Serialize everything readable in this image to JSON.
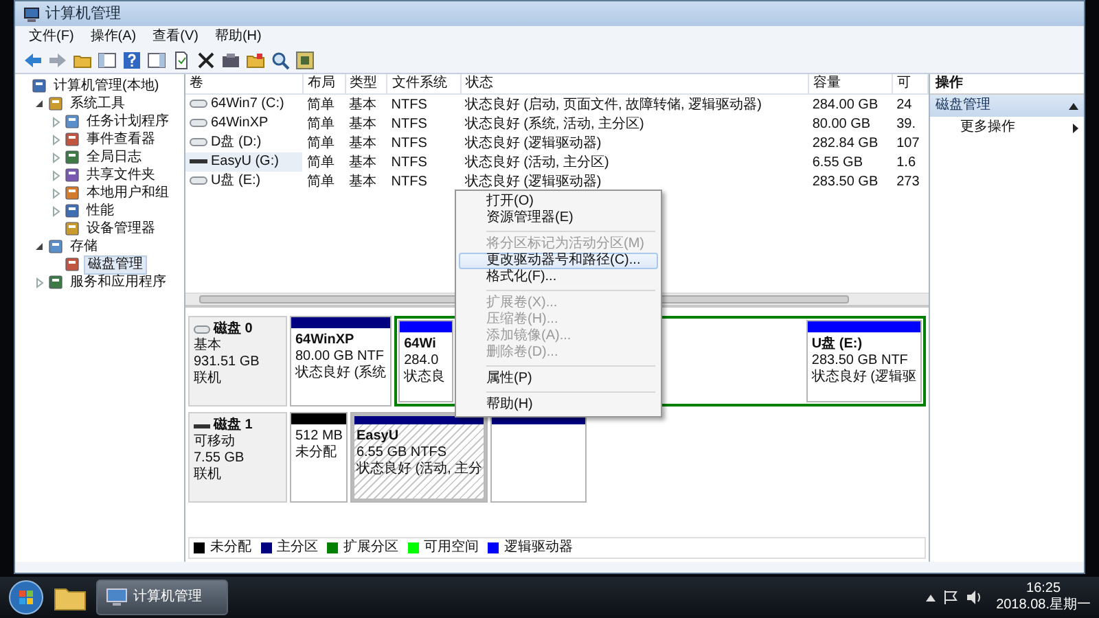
{
  "window": {
    "title": "计算机管理"
  },
  "menu": [
    "文件(F)",
    "操作(A)",
    "查看(V)",
    "帮助(H)"
  ],
  "tree": [
    {
      "label": "计算机管理(本地)",
      "selected": false,
      "children": [
        {
          "label": "系统工具",
          "expanded": true,
          "selected": false,
          "children": [
            {
              "label": "任务计划程序",
              "expanded": false,
              "selected": false
            },
            {
              "label": "事件查看器",
              "expanded": false,
              "selected": false
            },
            {
              "label": "全局日志",
              "expanded": false,
              "selected": false
            },
            {
              "label": "共享文件夹",
              "expanded": false,
              "selected": false
            },
            {
              "label": "本地用户和组",
              "expanded": false,
              "selected": false
            },
            {
              "label": "性能",
              "expanded": false,
              "selected": false
            },
            {
              "label": "设备管理器",
              "selected": false
            }
          ]
        },
        {
          "label": "存储",
          "expanded": true,
          "selected": false,
          "children": [
            {
              "label": "磁盘管理",
              "selected": true
            }
          ]
        },
        {
          "label": "服务和应用程序",
          "expanded": false,
          "selected": false
        }
      ]
    }
  ],
  "table": {
    "columns": [
      "卷",
      "布局",
      "类型",
      "文件系统",
      "状态",
      "容量",
      "可"
    ],
    "rows": [
      {
        "kind": "disk",
        "selected": false,
        "cells": [
          "64Win7  (C:)",
          "简单",
          "基本",
          "NTFS",
          "状态良好 (启动, 页面文件, 故障转储, 逻辑驱动器)",
          "284.00 GB",
          "24"
        ]
      },
      {
        "kind": "disk",
        "selected": false,
        "cells": [
          "64WinXP",
          "简单",
          "基本",
          "NTFS",
          "状态良好 (系统, 活动, 主分区)",
          "80.00 GB",
          "39."
        ]
      },
      {
        "kind": "disk",
        "selected": false,
        "cells": [
          "D盘 (D:)",
          "简单",
          "基本",
          "NTFS",
          "状态良好 (逻辑驱动器)",
          "282.84 GB",
          "107"
        ]
      },
      {
        "kind": "removable",
        "selected": true,
        "cells": [
          "EasyU (G:)",
          "简单",
          "基本",
          "NTFS",
          "状态良好 (活动, 主分区)",
          "6.55 GB",
          "1.6"
        ]
      },
      {
        "kind": "disk",
        "selected": false,
        "cells": [
          "U盘 (E:)",
          "简单",
          "基本",
          "NTFS",
          "状态良好 (逻辑驱动器)",
          "283.50 GB",
          "273"
        ]
      }
    ]
  },
  "disks": [
    {
      "kind": "disk",
      "name": "磁盘 0",
      "type": "基本",
      "size": "931.51 GB",
      "status": "联机",
      "partitions": [
        {
          "kind": "partition",
          "color": "#000080",
          "selected": false,
          "name": "64WinXP",
          "size": "80.00 GB NTF",
          "status": "状态良好 (系统"
        },
        {
          "kind": "extended",
          "color": "#008000",
          "children": [
            {
              "kind": "partition",
              "color": "#0000ff",
              "selected": false,
              "name": "64Wi",
              "size": "284.0",
              "status": "状态良"
            },
            {
              "kind": "partition",
              "color": "#0000ff",
              "selected": false,
              "name": "U盘  (E:)",
              "size": "283.50 GB NTF",
              "status": "状态良好 (逻辑驱"
            }
          ]
        }
      ]
    },
    {
      "kind": "removable",
      "name": "磁盘 1",
      "type": "可移动",
      "size": "7.55 GB",
      "status": "联机",
      "partitions": [
        {
          "kind": "partition",
          "color": "#000000",
          "selected": false,
          "size": "512 MB",
          "status": "未分配"
        },
        {
          "kind": "partition",
          "color": "#000080",
          "selected": true,
          "name": "EasyU",
          "size": "6.55 GB NTFS",
          "status": "状态良好 (活动, 主分"
        },
        {
          "kind": "partition",
          "color": "#000080",
          "selected": false
        }
      ]
    }
  ],
  "legend": [
    {
      "label": "未分配",
      "color": "#000000"
    },
    {
      "label": "主分区",
      "color": "#000080"
    },
    {
      "label": "扩展分区",
      "color": "#008000"
    },
    {
      "label": "可用空间",
      "color": "#00ff00"
    },
    {
      "label": "逻辑驱动器",
      "color": "#0000ff"
    }
  ],
  "actions": {
    "title": "操作",
    "section": {
      "label": "磁盘管理",
      "expanded": true
    },
    "items": [
      {
        "label": "更多操作"
      }
    ]
  },
  "context_menu": [
    {
      "kind": "item",
      "label": "打开(O)",
      "disabled": false,
      "selected": false
    },
    {
      "kind": "item",
      "label": "资源管理器(E)",
      "disabled": false,
      "selected": false
    },
    {
      "kind": "separator"
    },
    {
      "kind": "item",
      "label": "将分区标记为活动分区(M)",
      "disabled": true,
      "selected": false
    },
    {
      "kind": "item",
      "label": "更改驱动器号和路径(C)...",
      "disabled": false,
      "selected": true
    },
    {
      "kind": "item",
      "label": "格式化(F)...",
      "disabled": false,
      "selected": false
    },
    {
      "kind": "separator"
    },
    {
      "kind": "item",
      "label": "扩展卷(X)...",
      "disabled": true,
      "selected": false
    },
    {
      "kind": "item",
      "label": "压缩卷(H)...",
      "disabled": true,
      "selected": false
    },
    {
      "kind": "item",
      "label": "添加镜像(A)...",
      "disabled": true,
      "selected": false
    },
    {
      "kind": "item",
      "label": "删除卷(D)...",
      "disabled": true,
      "selected": false
    },
    {
      "kind": "separator"
    },
    {
      "kind": "item",
      "label": "属性(P)",
      "disabled": false,
      "selected": false
    },
    {
      "kind": "separator"
    },
    {
      "kind": "item",
      "label": "帮助(H)",
      "disabled": false,
      "selected": false
    }
  ],
  "taskbar": {
    "tasks": [
      {
        "label": "计算机管理",
        "selected": true
      }
    ],
    "time": "16:25",
    "date": "2018.08.星期一"
  }
}
